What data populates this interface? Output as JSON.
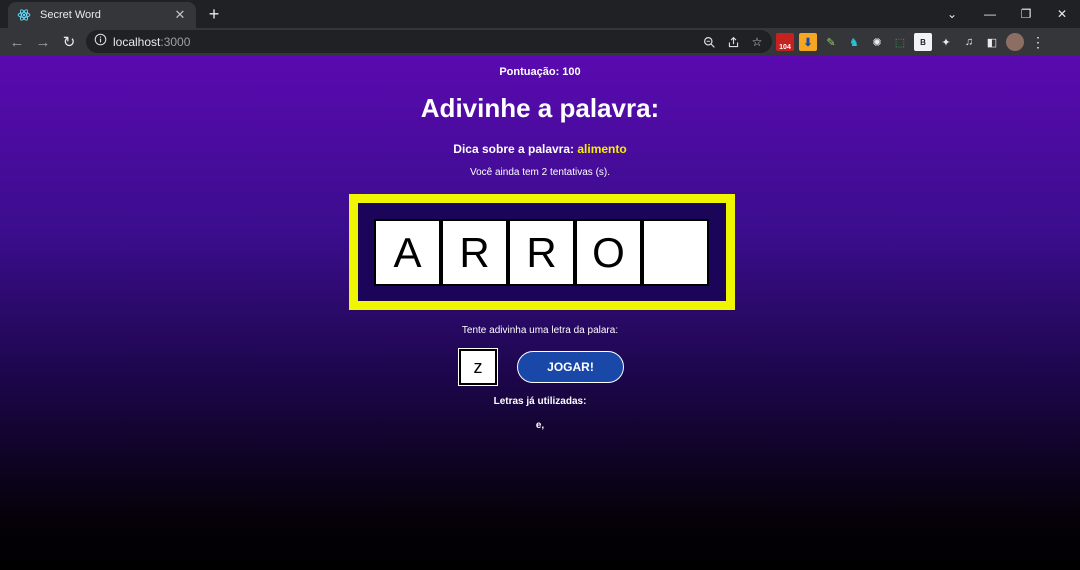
{
  "browser": {
    "tab_title": "Secret Word",
    "url_host": "localhost",
    "url_port": ":3000",
    "extension_badge": "104"
  },
  "game": {
    "score_label": "Pontuação: 100",
    "heading": "Adivinhe a palavra:",
    "tip_label": "Dica sobre a palavra: ",
    "tip_word": "alimento",
    "attempts_text": "Você ainda tem 2 tentativas (s).",
    "letters": [
      "A",
      "R",
      "R",
      "O",
      ""
    ],
    "guess_prompt": "Tente adivinha uma letra da palara:",
    "guess_value": "z",
    "play_button": "JOGAR!",
    "used_letters_label": "Letras já utilizadas:",
    "used_letters": "e,"
  },
  "colors": {
    "frame": "#f0f500",
    "tip_word": "#f5f000",
    "button_bg": "#1a48a8",
    "bg_top": "#5a0ab0",
    "bg_bottom": "#000000"
  }
}
